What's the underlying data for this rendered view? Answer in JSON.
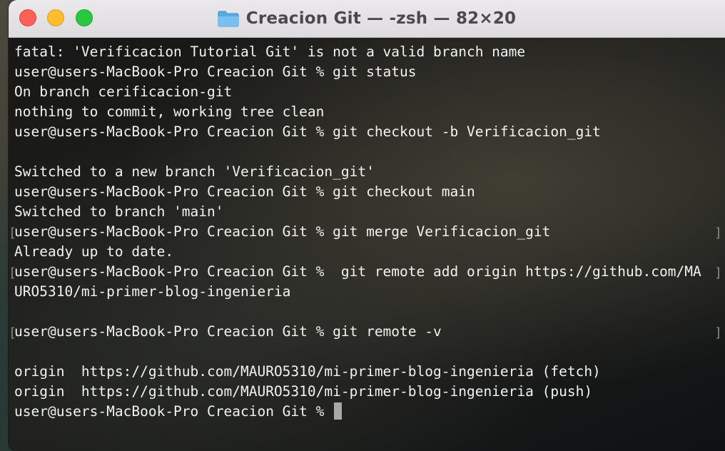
{
  "window": {
    "title": "Creacion Git — -zsh — 82×20",
    "folder_icon": "folder-icon"
  },
  "terminal": {
    "lines": [
      {
        "text": "fatal: 'Verificacion Tutorial Git' is not a valid branch name",
        "bracket": false
      },
      {
        "text": "user@users-MacBook-Pro Creacion Git % git status",
        "bracket": false
      },
      {
        "text": "On branch cerificacion-git",
        "bracket": false
      },
      {
        "text": "nothing to commit, working tree clean",
        "bracket": false
      },
      {
        "text": "user@users-MacBook-Pro Creacion Git % git checkout -b Verificacion_git",
        "bracket": false
      },
      {
        "text": "",
        "bracket": false
      },
      {
        "text": "Switched to a new branch 'Verificacion_git'",
        "bracket": false
      },
      {
        "text": "user@users-MacBook-Pro Creacion Git % git checkout main",
        "bracket": false
      },
      {
        "text": "Switched to branch 'main'",
        "bracket": false
      },
      {
        "text": "user@users-MacBook-Pro Creacion Git % git merge Verificacion_git",
        "bracket": true
      },
      {
        "text": "Already up to date.",
        "bracket": false
      },
      {
        "text": "user@users-MacBook-Pro Creacion Git %  git remote add origin https://github.com/MA",
        "bracket": true
      },
      {
        "text": "URO5310/mi-primer-blog-ingenieria",
        "bracket": false
      },
      {
        "text": "",
        "bracket": false
      },
      {
        "text": "user@users-MacBook-Pro Creacion Git % git remote -v",
        "bracket": true
      },
      {
        "text": "",
        "bracket": false
      },
      {
        "text": "origin  https://github.com/MAURO5310/mi-primer-blog-ingenieria (fetch)",
        "bracket": false
      },
      {
        "text": "origin  https://github.com/MAURO5310/mi-primer-blog-ingenieria (push)",
        "bracket": false
      }
    ],
    "prompt": "user@users-MacBook-Pro Creacion Git % "
  },
  "colors": {
    "close": "#fe5f57",
    "minimize": "#febc2e",
    "maximize": "#28c840",
    "terminal_text": "#f2f2f2"
  }
}
